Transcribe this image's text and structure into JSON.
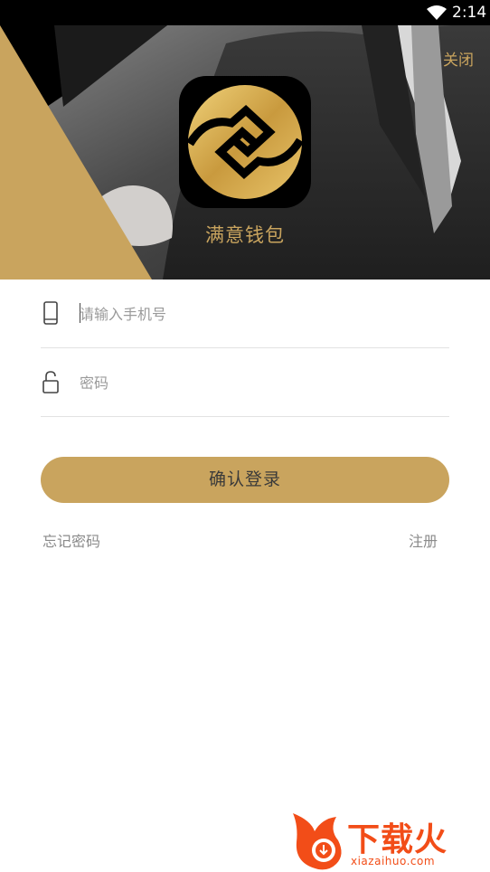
{
  "status_bar": {
    "time": "2:14",
    "wifi_icon": "wifi-icon"
  },
  "header": {
    "close_label": "关闭",
    "app_name": "满意钱包",
    "logo_icon": "wallet-logo-icon"
  },
  "form": {
    "phone": {
      "placeholder": "请输入手机号",
      "value": "",
      "icon": "phone-icon"
    },
    "password": {
      "placeholder": "密码",
      "value": "",
      "icon": "unlock-icon"
    },
    "submit_label": "确认登录"
  },
  "links": {
    "forgot_password": "忘记密码",
    "register": "注册"
  },
  "watermark": {
    "text": "下载火",
    "url": "xiazaihuo.com"
  },
  "colors": {
    "accent": "#c9a45e",
    "watermark": "#f24d18"
  }
}
